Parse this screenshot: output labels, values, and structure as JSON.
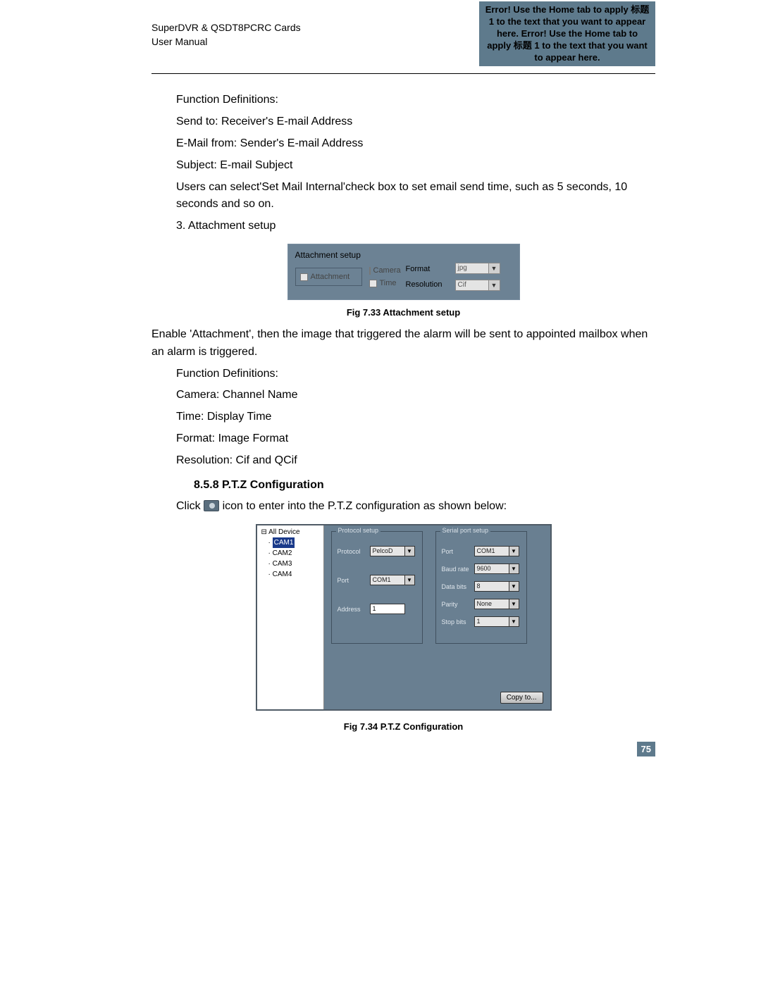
{
  "header": {
    "left_line1": "SuperDVR & QSDT8PCRC Cards",
    "left_line2": "User Manual",
    "right_text": "Error! Use the Home tab to apply 标题 1 to the text that you want to appear here. Error! Use the Home tab to apply 标题 1 to the text that you want to appear here."
  },
  "body": {
    "p1": "Function Definitions:",
    "p2": "Send to: Receiver's E-mail Address",
    "p3": "E-Mail from: Sender's E-mail Address",
    "p4": "Subject: E-mail Subject",
    "p5": "Users can select'Set Mail Internal'check box to set email send time, such as 5 seconds, 10 seconds and so on.",
    "p6": "3. Attachment setup",
    "p7": "Enable 'Attachment', then the image that triggered the alarm will be sent to appointed mailbox when an alarm is triggered.",
    "p8": "Function Definitions:",
    "p9": "Camera: Channel Name",
    "p10": "Time: Display Time",
    "p11": "Format: Image Format",
    "p12": "Resolution: Cif and QCif",
    "section_858": "8.5.8  P.T.Z Configuration",
    "p13a": "Click ",
    "p13b": " icon to enter into the P.T.Z configuration as shown below:"
  },
  "fig733": {
    "caption": "Fig 7.33 Attachment setup",
    "title": "Attachment setup",
    "attachment_label": "Attachment",
    "camera_label": "Camera",
    "time_label": "Time",
    "format_label": "Format",
    "resolution_label": "Resolution",
    "format_value": "jpg",
    "resolution_value": "Cif"
  },
  "fig734": {
    "caption": "Fig 7.34 P.T.Z Configuration",
    "tree": {
      "root": "All Device",
      "items": [
        "CAM1",
        "CAM2",
        "CAM3",
        "CAM4"
      ],
      "selected": "CAM1"
    },
    "protocol_group": "Protocol setup",
    "serial_group": "Serial port setup",
    "fields": {
      "protocol_label": "Protocol",
      "protocol_value": "PelcoD",
      "port_label_left": "Port",
      "port_value_left": "COM1",
      "address_label": "Address",
      "address_value": "1",
      "port_label_right": "Port",
      "port_value_right": "COM1",
      "baud_label": "Baud rate",
      "baud_value": "9600",
      "databits_label": "Data bits",
      "databits_value": "8",
      "parity_label": "Parity",
      "parity_value": "None",
      "stopbits_label": "Stop bits",
      "stopbits_value": "1"
    },
    "copy_button": "Copy to..."
  },
  "page_number": "75"
}
